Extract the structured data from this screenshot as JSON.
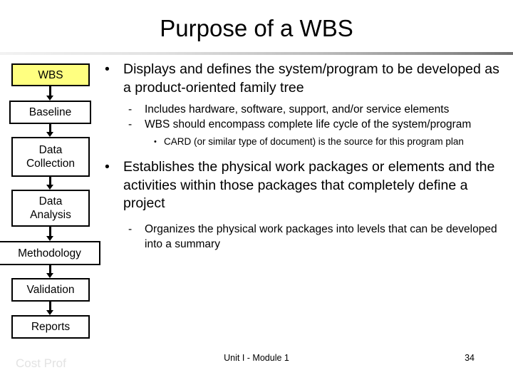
{
  "slide": {
    "title": "Purpose of a WBS",
    "footer_center": "Unit I - Module 1",
    "page_number": "34",
    "watermark": "Cost Prof",
    "accent_highlight_color": "#ffff80",
    "divider_color_left": "#f2f2f2",
    "divider_color_right": "#6e6e6e"
  },
  "flowchart": {
    "boxes": [
      {
        "label": "WBS",
        "highlight": true
      },
      {
        "label": "Baseline",
        "highlight": false
      },
      {
        "label": "Data\nCollection",
        "highlight": false
      },
      {
        "label": "Data\nAnalysis",
        "highlight": false
      },
      {
        "label": "Methodology",
        "highlight": false
      },
      {
        "label": "Validation",
        "highlight": false
      },
      {
        "label": "Reports",
        "highlight": false
      }
    ]
  },
  "body": {
    "bullets": [
      {
        "level": 1,
        "marker": "•",
        "text": "Displays and defines the system/program to be developed as a product-oriented family tree"
      },
      {
        "level": 2,
        "marker": "-",
        "text": "Includes hardware, software, support, and/or service elements"
      },
      {
        "level": 2,
        "marker": "-",
        "text": "WBS should encompass complete life cycle of the system/program"
      },
      {
        "level": 3,
        "marker": "•",
        "text": "CARD (or similar type of document) is the source for this program plan"
      },
      {
        "level": 1,
        "marker": "•",
        "text": "Establishes the physical work packages or elements and the activities within those packages that completely define a project"
      },
      {
        "level": 2,
        "marker": "-",
        "text": "Organizes the physical work packages into levels that can be developed into a summary"
      }
    ]
  }
}
